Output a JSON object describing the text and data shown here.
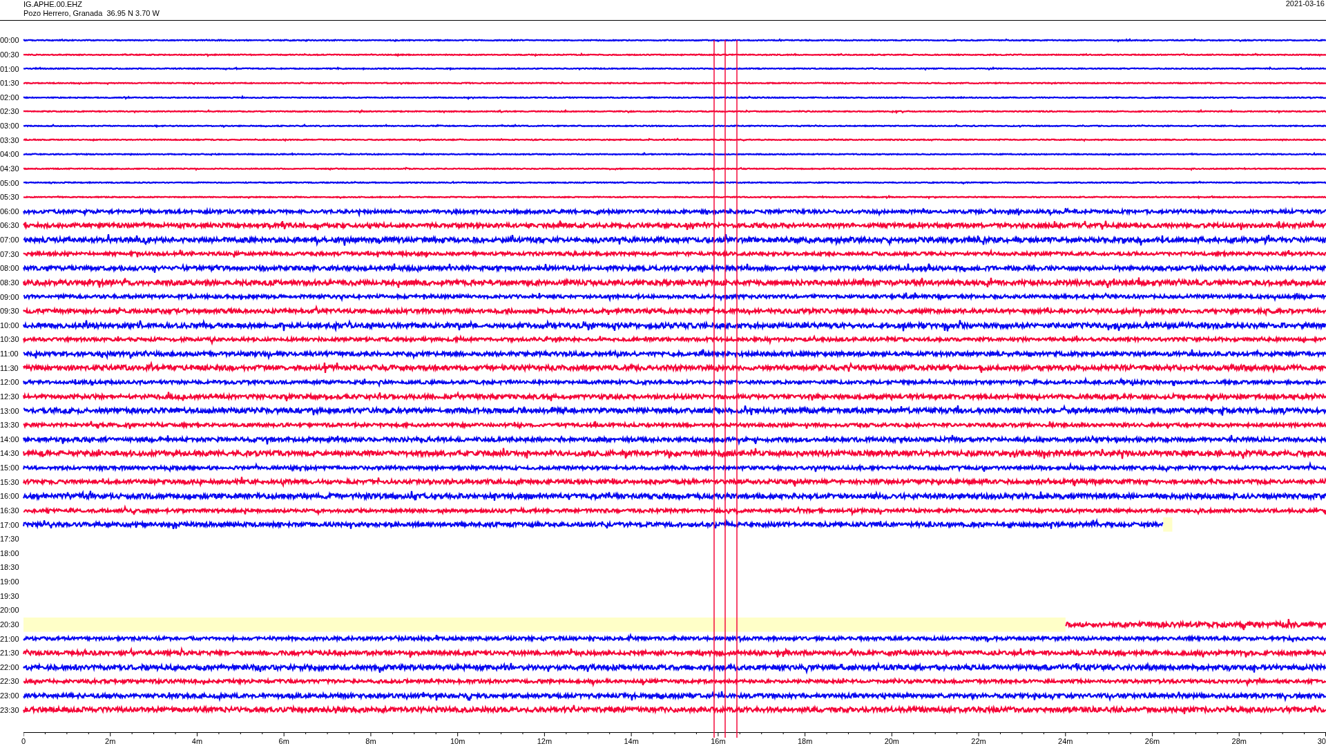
{
  "header": {
    "station": "IG.APHE.00.EHZ",
    "location": "Pozo Herrero, Granada  36.95 N 3.70 W",
    "date": "2021-03-16"
  },
  "rows": [
    {
      "time": "00:00",
      "color": "#0a0af0",
      "kind": "full"
    },
    {
      "time": "00:30",
      "color": "#f5093a",
      "kind": "full"
    },
    {
      "time": "01:00",
      "color": "#0a0af0",
      "kind": "full"
    },
    {
      "time": "01:30",
      "color": "#f5093a",
      "kind": "full"
    },
    {
      "time": "02:00",
      "color": "#0a0af0",
      "kind": "full"
    },
    {
      "time": "02:30",
      "color": "#f5093a",
      "kind": "full"
    },
    {
      "time": "03:00",
      "color": "#0a0af0",
      "kind": "full"
    },
    {
      "time": "03:30",
      "color": "#f5093a",
      "kind": "full"
    },
    {
      "time": "04:00",
      "color": "#0a0af0",
      "kind": "full"
    },
    {
      "time": "04:30",
      "color": "#f5093a",
      "kind": "full"
    },
    {
      "time": "05:00",
      "color": "#0a0af0",
      "kind": "full"
    },
    {
      "time": "05:30",
      "color": "#f5093a",
      "kind": "full"
    },
    {
      "time": "06:00",
      "color": "#0a0af0",
      "kind": "full"
    },
    {
      "time": "06:30",
      "color": "#f5093a",
      "kind": "full"
    },
    {
      "time": "07:00",
      "color": "#0a0af0",
      "kind": "full"
    },
    {
      "time": "07:30",
      "color": "#f5093a",
      "kind": "full"
    },
    {
      "time": "08:00",
      "color": "#0a0af0",
      "kind": "full"
    },
    {
      "time": "08:30",
      "color": "#f5093a",
      "kind": "full"
    },
    {
      "time": "09:00",
      "color": "#0a0af0",
      "kind": "full"
    },
    {
      "time": "09:30",
      "color": "#f5093a",
      "kind": "full"
    },
    {
      "time": "10:00",
      "color": "#0a0af0",
      "kind": "full"
    },
    {
      "time": "10:30",
      "color": "#f5093a",
      "kind": "full"
    },
    {
      "time": "11:00",
      "color": "#0a0af0",
      "kind": "full"
    },
    {
      "time": "11:30",
      "color": "#f5093a",
      "kind": "full"
    },
    {
      "time": "12:00",
      "color": "#0a0af0",
      "kind": "full"
    },
    {
      "time": "12:30",
      "color": "#f5093a",
      "kind": "full"
    },
    {
      "time": "13:00",
      "color": "#0a0af0",
      "kind": "full"
    },
    {
      "time": "13:30",
      "color": "#f5093a",
      "kind": "full"
    },
    {
      "time": "14:00",
      "color": "#0a0af0",
      "kind": "full"
    },
    {
      "time": "14:30",
      "color": "#f5093a",
      "kind": "full"
    },
    {
      "time": "15:00",
      "color": "#0a0af0",
      "kind": "full"
    },
    {
      "time": "15:30",
      "color": "#f5093a",
      "kind": "full"
    },
    {
      "time": "16:00",
      "color": "#0a0af0",
      "kind": "full"
    },
    {
      "time": "16:30",
      "color": "#f5093a",
      "kind": "full"
    },
    {
      "time": "17:00",
      "color": "#0a0af0",
      "kind": "ends_early"
    },
    {
      "time": "17:30",
      "kind": "empty"
    },
    {
      "time": "18:00",
      "kind": "empty"
    },
    {
      "time": "18:30",
      "kind": "empty"
    },
    {
      "time": "19:00",
      "kind": "empty"
    },
    {
      "time": "19:30",
      "kind": "empty"
    },
    {
      "time": "20:00",
      "kind": "empty"
    },
    {
      "time": "20:30",
      "color": "#f5093a",
      "kind": "starts_late"
    },
    {
      "time": "21:00",
      "color": "#0a0af0",
      "kind": "full"
    },
    {
      "time": "21:30",
      "color": "#f5093a",
      "kind": "full"
    },
    {
      "time": "22:00",
      "color": "#0a0af0",
      "kind": "full"
    },
    {
      "time": "22:30",
      "color": "#f5093a",
      "kind": "full"
    },
    {
      "time": "23:00",
      "color": "#0a0af0",
      "kind": "full"
    },
    {
      "time": "23:30",
      "color": "#f5093a",
      "kind": "full"
    }
  ],
  "axis": {
    "ticks": [
      "0",
      "2m",
      "4m",
      "6m",
      "8m",
      "10m",
      "12m",
      "14m",
      "16m",
      "18m",
      "20m",
      "22m",
      "24m",
      "26m",
      "28m",
      "30"
    ]
  }
}
